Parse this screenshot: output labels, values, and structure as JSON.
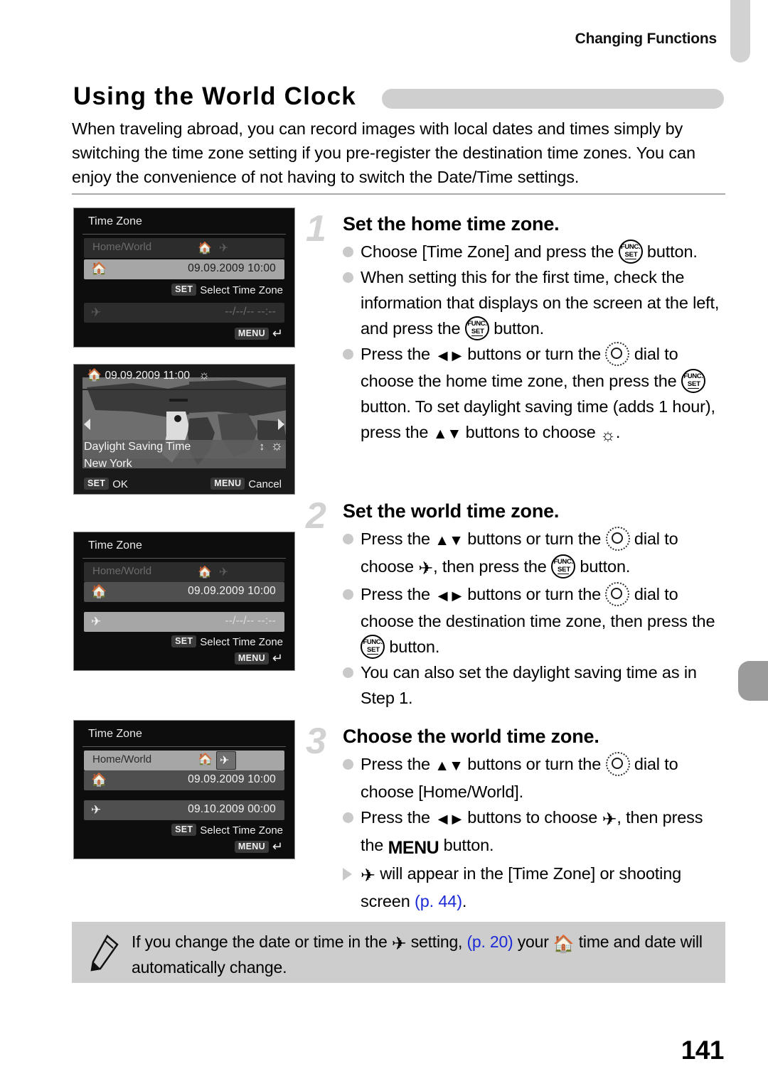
{
  "header": {
    "running_title": "Changing Functions",
    "page_title": "Using the World Clock",
    "page_number": "141"
  },
  "intro": "When traveling abroad, you can record images with local dates and times simply by switching the time zone setting if you pre-register the destination time zones. You can enjoy the convenience of not having to switch the Date/Time settings.",
  "screens": [
    {
      "id": "time-zone-home-selected",
      "title": "Time Zone",
      "rows": [
        {
          "label": "Home/World",
          "value": "",
          "state": "dim"
        },
        {
          "label": "home-icon",
          "value": "09.09.2009 10:00",
          "state": "sel"
        },
        {
          "label": "plane-icon",
          "value": "--/--/-- --:--",
          "state": "dim"
        }
      ],
      "hint_set": "Select Time Zone",
      "badge_set": "SET",
      "badge_menu": "MENU"
    },
    {
      "id": "world-map",
      "top_time": "09.09.2009 11:00",
      "dst_label": "Daylight Saving Time",
      "city": "New York",
      "foot_left_badge": "SET",
      "foot_left_label": "OK",
      "foot_right_badge": "MENU",
      "foot_right_label": "Cancel"
    },
    {
      "id": "time-zone-world-selected",
      "title": "Time Zone",
      "rows": [
        {
          "label": "Home/World",
          "value": "",
          "state": "dim"
        },
        {
          "label": "home-icon",
          "value": "09.09.2009 10:00",
          "state": "mid"
        },
        {
          "label": "plane-icon",
          "value": "--/--/-- --:--",
          "state": "sel"
        }
      ],
      "hint_set": "Select Time Zone",
      "badge_set": "SET",
      "badge_menu": "MENU"
    },
    {
      "id": "time-zone-home-world-row",
      "title": "Time Zone",
      "rows": [
        {
          "label": "Home/World",
          "value": "",
          "state": "sel"
        },
        {
          "label": "home-icon",
          "value": "09.09.2009 10:00",
          "state": "mid"
        },
        {
          "label": "plane-icon",
          "value": "09.10.2009 00:00",
          "state": "mid"
        }
      ],
      "hint_set": "Select Time Zone",
      "badge_set": "SET",
      "badge_menu": "MENU"
    }
  ],
  "steps": [
    {
      "number": "1",
      "heading": "Set the home time zone.",
      "bullets": [
        {
          "marker": "dot",
          "parts": [
            {
              "t": "text",
              "v": "Choose [Time Zone] and press the "
            },
            {
              "t": "icon",
              "v": "func-set-icon"
            },
            {
              "t": "text",
              "v": " button."
            }
          ]
        },
        {
          "marker": "dot",
          "parts": [
            {
              "t": "text",
              "v": "When setting this for the first time, check the information that displays on the screen at the left, and press the "
            },
            {
              "t": "icon",
              "v": "func-set-icon"
            },
            {
              "t": "text",
              "v": " button."
            }
          ]
        },
        {
          "marker": "dot",
          "parts": [
            {
              "t": "text",
              "v": "Press the "
            },
            {
              "t": "icon",
              "v": "left-right-icon"
            },
            {
              "t": "text",
              "v": " buttons or turn the "
            },
            {
              "t": "icon",
              "v": "control-dial-icon"
            },
            {
              "t": "text",
              "v": " dial to choose the home time zone, then press the "
            },
            {
              "t": "icon",
              "v": "func-set-icon"
            },
            {
              "t": "text",
              "v": " button. To set daylight saving time (adds 1 hour), press the "
            },
            {
              "t": "icon",
              "v": "up-down-icon"
            },
            {
              "t": "text",
              "v": " buttons to choose "
            },
            {
              "t": "icon",
              "v": "sun-icon"
            },
            {
              "t": "text",
              "v": "."
            }
          ]
        }
      ]
    },
    {
      "number": "2",
      "heading": "Set the world time zone.",
      "bullets": [
        {
          "marker": "dot",
          "parts": [
            {
              "t": "text",
              "v": "Press the "
            },
            {
              "t": "icon",
              "v": "up-down-icon"
            },
            {
              "t": "text",
              "v": " buttons or turn the "
            },
            {
              "t": "icon",
              "v": "control-dial-icon"
            },
            {
              "t": "text",
              "v": " dial to choose "
            },
            {
              "t": "icon",
              "v": "plane-icon"
            },
            {
              "t": "text",
              "v": ", then press the "
            },
            {
              "t": "icon",
              "v": "func-set-icon"
            },
            {
              "t": "text",
              "v": " button."
            }
          ]
        },
        {
          "marker": "dot",
          "parts": [
            {
              "t": "text",
              "v": "Press the "
            },
            {
              "t": "icon",
              "v": "left-right-icon"
            },
            {
              "t": "text",
              "v": " buttons or turn the "
            },
            {
              "t": "icon",
              "v": "control-dial-icon"
            },
            {
              "t": "text",
              "v": " dial to choose the destination time zone, then press the "
            },
            {
              "t": "icon",
              "v": "func-set-icon"
            },
            {
              "t": "text",
              "v": " button."
            }
          ]
        },
        {
          "marker": "dot",
          "parts": [
            {
              "t": "text",
              "v": "You can also set the daylight saving time as in Step 1."
            }
          ]
        }
      ]
    },
    {
      "number": "3",
      "heading": "Choose the world time zone.",
      "bullets": [
        {
          "marker": "dot",
          "parts": [
            {
              "t": "text",
              "v": "Press the "
            },
            {
              "t": "icon",
              "v": "up-down-icon"
            },
            {
              "t": "text",
              "v": " buttons or turn the "
            },
            {
              "t": "icon",
              "v": "control-dial-icon"
            },
            {
              "t": "text",
              "v": " dial to choose [Home/World]."
            }
          ]
        },
        {
          "marker": "dot",
          "parts": [
            {
              "t": "text",
              "v": "Press the "
            },
            {
              "t": "icon",
              "v": "left-right-icon"
            },
            {
              "t": "text",
              "v": " buttons to choose "
            },
            {
              "t": "icon",
              "v": "plane-icon"
            },
            {
              "t": "text",
              "v": ", then press the "
            },
            {
              "t": "icon",
              "v": "menu-icon"
            },
            {
              "t": "text",
              "v": " button."
            }
          ]
        },
        {
          "marker": "triangle",
          "parts": [
            {
              "t": "icon",
              "v": "plane-icon"
            },
            {
              "t": "text",
              "v": " will appear in the [Time Zone] or shooting screen "
            },
            {
              "t": "ref",
              "v": "(p. 44)"
            },
            {
              "t": "text",
              "v": "."
            }
          ]
        }
      ]
    }
  ],
  "note": {
    "icon": "pencil-icon",
    "parts": [
      {
        "t": "text",
        "v": "If you change the date or time in the "
      },
      {
        "t": "icon",
        "v": "plane-icon"
      },
      {
        "t": "text",
        "v": " setting, "
      },
      {
        "t": "ref",
        "v": "(p. 20)"
      },
      {
        "t": "text",
        "v": " your "
      },
      {
        "t": "icon",
        "v": "home-icon"
      },
      {
        "t": "text",
        "v": " time and date will automatically change."
      }
    ]
  },
  "colors": {
    "tab_top": "#d2d2d2",
    "tab_side": "#9b9b9b",
    "title_bar": "#cfcfcf",
    "note_bg": "#cdcdcd",
    "link": "#1b2ad6",
    "step_number": "#d2d2d2"
  }
}
